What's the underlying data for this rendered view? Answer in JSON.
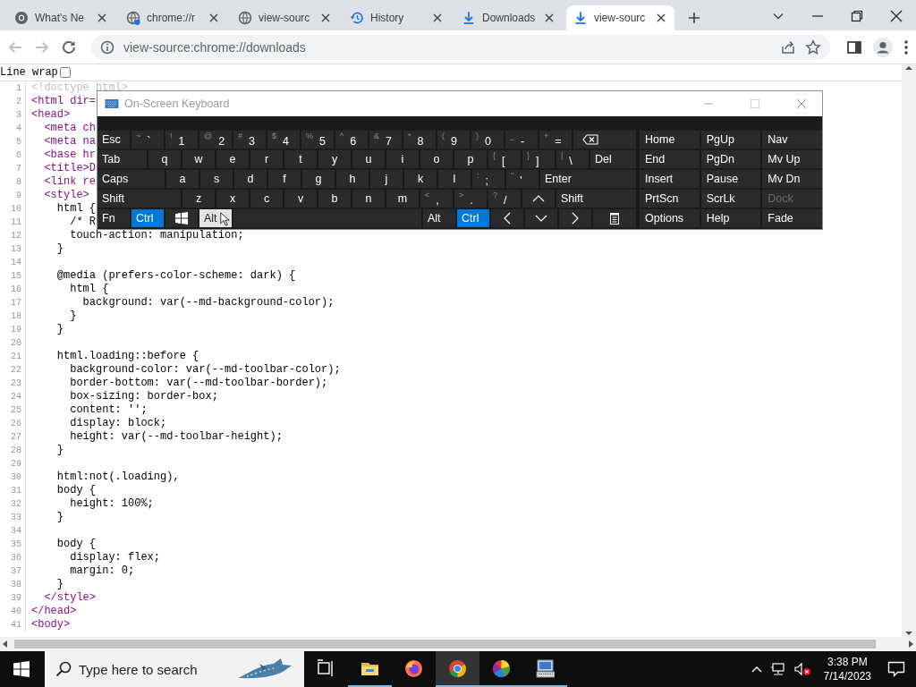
{
  "tabs": [
    {
      "kind": "logo",
      "label": "What's Ne",
      "selected": false
    },
    {
      "kind": "globe-dot",
      "label": "chrome://r",
      "selected": false
    },
    {
      "kind": "globe",
      "label": "view-sourc",
      "selected": false
    },
    {
      "kind": "history",
      "label": "History",
      "selected": false
    },
    {
      "kind": "download",
      "label": "Downloads",
      "selected": false
    },
    {
      "kind": "download",
      "label": "view-sourc",
      "selected": true
    }
  ],
  "navigation": {
    "back_disabled": true,
    "forward_disabled": true
  },
  "address_bar": {
    "url": "view-source:chrome://downloads"
  },
  "line_wrap": {
    "label": "Line wrap",
    "checked": false
  },
  "source_lines": [
    {
      "number": "1",
      "kind": "doctype",
      "text": "<!doctype html>"
    },
    {
      "number": "2",
      "kind": "tag",
      "text": "<html dir="
    },
    {
      "number": "3",
      "kind": "tag",
      "text": "<head>"
    },
    {
      "number": "4",
      "kind": "tag",
      "text": "  <meta ch"
    },
    {
      "number": "5",
      "kind": "tag",
      "text": "  <meta na"
    },
    {
      "number": "6",
      "kind": "tag",
      "text": "  <base hr"
    },
    {
      "number": "7",
      "kind": "tag",
      "text": "  <title>D"
    },
    {
      "number": "8",
      "kind": "tag",
      "text": "  <link re"
    },
    {
      "number": "9",
      "kind": "tag",
      "text": "  <style>"
    },
    {
      "number": "10",
      "kind": "css",
      "text": "    html {"
    },
    {
      "number": "11",
      "kind": "css",
      "text": "      /* R"
    },
    {
      "number": "12",
      "kind": "css",
      "text": "      touch-action: manipulation;"
    },
    {
      "number": "13",
      "kind": "css",
      "text": "    }"
    },
    {
      "number": "14"
    },
    {
      "number": "15",
      "kind": "css",
      "text": "    @media (prefers-color-scheme: dark) {"
    },
    {
      "number": "16",
      "kind": "css",
      "text": "      html {"
    },
    {
      "number": "17",
      "kind": "css",
      "text": "        background: var(--md-background-color);"
    },
    {
      "number": "18",
      "kind": "css",
      "text": "      }"
    },
    {
      "number": "19",
      "kind": "css",
      "text": "    }"
    },
    {
      "number": "20"
    },
    {
      "number": "21",
      "kind": "css",
      "text": "    html.loading::before {"
    },
    {
      "number": "22",
      "kind": "css",
      "text": "      background-color: var(--md-toolbar-color);"
    },
    {
      "number": "23",
      "kind": "css",
      "text": "      border-bottom: var(--md-toolbar-border);"
    },
    {
      "number": "24",
      "kind": "css",
      "text": "      box-sizing: border-box;"
    },
    {
      "number": "25",
      "kind": "css",
      "text": "      content: '';"
    },
    {
      "number": "26",
      "kind": "css",
      "text": "      display: block;"
    },
    {
      "number": "27",
      "kind": "css",
      "text": "      height: var(--md-toolbar-height);"
    },
    {
      "number": "28",
      "kind": "css",
      "text": "    }"
    },
    {
      "number": "29"
    },
    {
      "number": "30",
      "kind": "css",
      "text": "    html:not(.loading),"
    },
    {
      "number": "31",
      "kind": "css",
      "text": "    body {"
    },
    {
      "number": "32",
      "kind": "css",
      "text": "      height: 100%;"
    },
    {
      "number": "33",
      "kind": "css",
      "text": "    }"
    },
    {
      "number": "34"
    },
    {
      "number": "35",
      "kind": "css",
      "text": "    body {"
    },
    {
      "number": "36",
      "kind": "css",
      "text": "      display: flex;"
    },
    {
      "number": "37",
      "kind": "css",
      "text": "      margin: 0;"
    },
    {
      "number": "38",
      "kind": "css",
      "text": "    }"
    },
    {
      "number": "39",
      "kind": "tag",
      "text": "  </style>"
    },
    {
      "number": "40",
      "kind": "tag",
      "text": "</head>"
    },
    {
      "number": "41",
      "kind": "tag",
      "text": "<body>"
    }
  ],
  "keyboard": {
    "title": "On-Screen Keyboard",
    "rows": [
      {
        "keys": [
          {
            "kind": "mod",
            "label": "Esc",
            "on": false,
            "hovered": false
          },
          {
            "kind": "dual",
            "shift": "~",
            "label": "`",
            "on": false,
            "hovered": false
          },
          {
            "kind": "dual",
            "shift": "!",
            "label": "1",
            "on": false,
            "hovered": false
          },
          {
            "kind": "dual",
            "shift": "@",
            "label": "2",
            "on": false,
            "hovered": false
          },
          {
            "kind": "dual",
            "shift": "#",
            "label": "3",
            "on": false,
            "hovered": false
          },
          {
            "kind": "dual",
            "shift": "$",
            "label": "4",
            "on": false,
            "hovered": false
          },
          {
            "kind": "dual",
            "shift": "%",
            "label": "5",
            "on": false,
            "hovered": false
          },
          {
            "kind": "dual",
            "shift": "^",
            "label": "6",
            "on": false,
            "hovered": false
          },
          {
            "kind": "dual",
            "shift": "&",
            "label": "7",
            "on": false,
            "hovered": false
          },
          {
            "kind": "dual",
            "shift": "*",
            "label": "8",
            "on": false,
            "hovered": false
          },
          {
            "kind": "dual",
            "shift": "(",
            "label": "9",
            "on": false,
            "hovered": false
          },
          {
            "kind": "dual",
            "shift": ")",
            "label": "0",
            "on": false,
            "hovered": false
          },
          {
            "kind": "dual",
            "shift": "_",
            "label": "-",
            "on": false,
            "hovered": false
          },
          {
            "kind": "dual",
            "shift": "+",
            "label": "=",
            "on": false,
            "hovered": false
          },
          {
            "kind": "backspace",
            "on": false,
            "hovered": false
          }
        ]
      },
      {
        "keys": [
          {
            "kind": "tab",
            "label": "Tab",
            "on": false,
            "hovered": false
          },
          {
            "kind": "char",
            "label": "q",
            "on": false,
            "hovered": false
          },
          {
            "kind": "char",
            "label": "w",
            "on": false,
            "hovered": false
          },
          {
            "kind": "char",
            "label": "e",
            "on": false,
            "hovered": false
          },
          {
            "kind": "char",
            "label": "r",
            "on": false,
            "hovered": false
          },
          {
            "kind": "char",
            "label": "t",
            "on": false,
            "hovered": false
          },
          {
            "kind": "char",
            "label": "y",
            "on": false,
            "hovered": false
          },
          {
            "kind": "char",
            "label": "u",
            "on": false,
            "hovered": false
          },
          {
            "kind": "char",
            "label": "i",
            "on": false,
            "hovered": false
          },
          {
            "kind": "char",
            "label": "o",
            "on": false,
            "hovered": false
          },
          {
            "kind": "char",
            "label": "p",
            "on": false,
            "hovered": false
          },
          {
            "kind": "dual",
            "shift": "{",
            "label": "[",
            "on": false,
            "hovered": false
          },
          {
            "kind": "dual",
            "shift": "}",
            "label": "]",
            "on": false,
            "hovered": false
          },
          {
            "kind": "dual",
            "shift": "|",
            "label": "\\",
            "on": false,
            "hovered": false
          },
          {
            "kind": "fill",
            "label": "Del",
            "on": false,
            "hovered": false
          }
        ]
      },
      {
        "keys": [
          {
            "kind": "caps",
            "label": "Caps",
            "on": false,
            "hovered": false
          },
          {
            "kind": "char",
            "label": "a",
            "on": false,
            "hovered": false
          },
          {
            "kind": "char",
            "label": "s",
            "on": false,
            "hovered": false
          },
          {
            "kind": "char",
            "label": "d",
            "on": false,
            "hovered": false
          },
          {
            "kind": "char",
            "label": "f",
            "on": false,
            "hovered": false
          },
          {
            "kind": "char",
            "label": "g",
            "on": false,
            "hovered": false
          },
          {
            "kind": "char",
            "label": "h",
            "on": false,
            "hovered": false
          },
          {
            "kind": "char",
            "label": "j",
            "on": false,
            "hovered": false
          },
          {
            "kind": "char",
            "label": "k",
            "on": false,
            "hovered": false
          },
          {
            "kind": "char",
            "label": "l",
            "on": false,
            "hovered": false
          },
          {
            "kind": "dual",
            "shift": ":",
            "label": ";",
            "on": false,
            "hovered": false
          },
          {
            "kind": "dual",
            "shift": "\"",
            "label": "'",
            "on": false,
            "hovered": false
          },
          {
            "kind": "fill",
            "label": "Enter",
            "on": false,
            "hovered": false
          }
        ]
      },
      {
        "keys": [
          {
            "kind": "lshift",
            "label": "Shift",
            "on": false,
            "hovered": false
          },
          {
            "kind": "char",
            "label": "z",
            "on": false,
            "hovered": false
          },
          {
            "kind": "char",
            "label": "x",
            "on": false,
            "hovered": false
          },
          {
            "kind": "char",
            "label": "c",
            "on": false,
            "hovered": false
          },
          {
            "kind": "char",
            "label": "v",
            "on": false,
            "hovered": false
          },
          {
            "kind": "char",
            "label": "b",
            "on": false,
            "hovered": false
          },
          {
            "kind": "char",
            "label": "n",
            "on": false,
            "hovered": false
          },
          {
            "kind": "char",
            "label": "m",
            "on": false,
            "hovered": false
          },
          {
            "kind": "dual",
            "shift": "<",
            "label": ",",
            "on": false,
            "hovered": false
          },
          {
            "kind": "dual",
            "shift": ">",
            "label": ".",
            "on": false,
            "hovered": false
          },
          {
            "kind": "dual",
            "shift": "?",
            "label": "/",
            "on": false,
            "hovered": false
          },
          {
            "kind": "up",
            "on": false,
            "hovered": false
          },
          {
            "kind": "fill",
            "label": "Shift",
            "on": false,
            "hovered": false
          }
        ]
      },
      {
        "keys": [
          {
            "kind": "mod",
            "label": "Fn",
            "on": false,
            "hovered": false
          },
          {
            "kind": "mod",
            "label": "Ctrl",
            "on": true,
            "hovered": false
          },
          {
            "kind": "win",
            "on": false,
            "hovered": false
          },
          {
            "kind": "mod",
            "label": "Alt",
            "on": false,
            "hovered": true
          },
          {
            "kind": "space",
            "on": false,
            "hovered": false
          },
          {
            "kind": "mod",
            "label": "Alt",
            "on": false,
            "hovered": false
          },
          {
            "kind": "mod",
            "label": "Ctrl",
            "on": true,
            "hovered": false
          },
          {
            "kind": "left",
            "on": false,
            "hovered": false
          },
          {
            "kind": "down",
            "on": false,
            "hovered": false
          },
          {
            "kind": "right",
            "on": false,
            "hovered": false
          },
          {
            "kind": "menu",
            "on": false,
            "hovered": false
          }
        ]
      }
    ],
    "side_keys": [
      {
        "label": "Home",
        "disabled": false
      },
      {
        "label": "PgUp",
        "disabled": false
      },
      {
        "label": "Nav",
        "disabled": false
      },
      {
        "label": "End",
        "disabled": false
      },
      {
        "label": "PgDn",
        "disabled": false
      },
      {
        "label": "Mv Up",
        "disabled": false
      },
      {
        "label": "Insert",
        "disabled": false
      },
      {
        "label": "Pause",
        "disabled": false
      },
      {
        "label": "Mv Dn",
        "disabled": false
      },
      {
        "label": "PrtScn",
        "disabled": false
      },
      {
        "label": "ScrLk",
        "disabled": false
      },
      {
        "label": "Dock",
        "disabled": true
      },
      {
        "label": "Options",
        "disabled": false
      },
      {
        "label": "Help",
        "disabled": false
      },
      {
        "label": "Fade",
        "disabled": false
      }
    ]
  },
  "taskbar": {
    "search": {
      "placeholder": "Type here to search"
    },
    "apps": [
      {
        "kind": "taskview",
        "running": false,
        "active": false
      },
      {
        "kind": "explorer",
        "running": true,
        "active": false
      },
      {
        "kind": "firefox",
        "running": false,
        "active": false
      },
      {
        "kind": "chrome",
        "running": true,
        "active": true
      },
      {
        "kind": "colorwheel",
        "running": true,
        "active": false
      },
      {
        "kind": "keyboard",
        "running": true,
        "active": false
      }
    ],
    "time": "3:38 PM",
    "date": "7/14/2023"
  }
}
